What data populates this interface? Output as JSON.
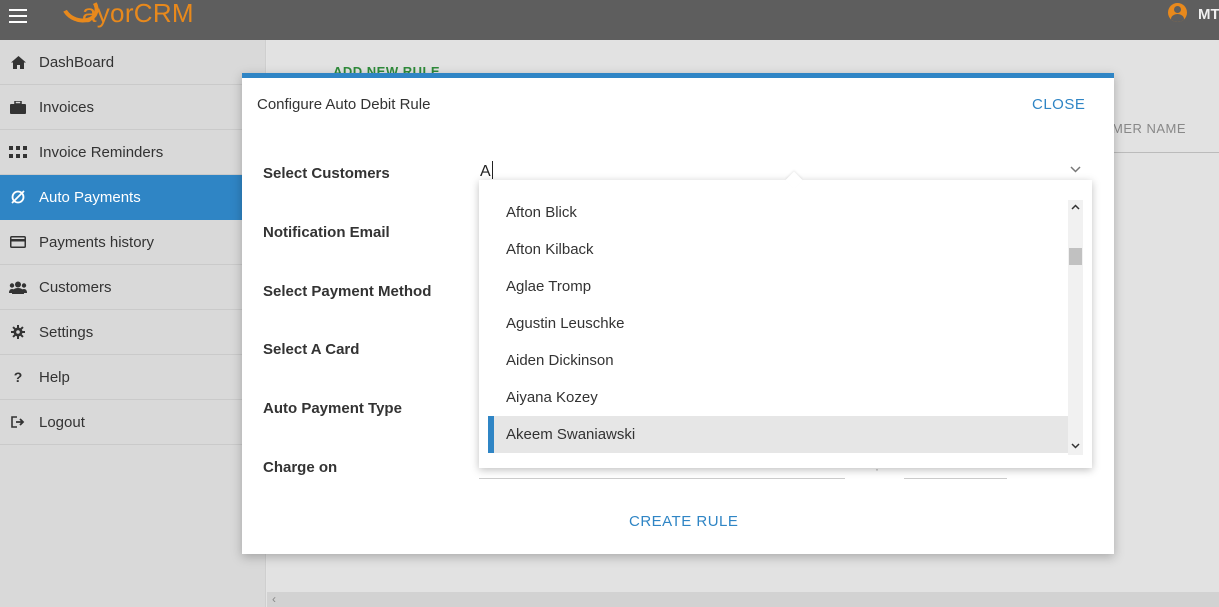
{
  "app": {
    "logo_text": "ayorCRM",
    "user_initials": "MT"
  },
  "sidebar": {
    "items": [
      {
        "label": "DashBoard",
        "icon": "home-icon",
        "active": false
      },
      {
        "label": "Invoices",
        "icon": "briefcase-icon",
        "active": false
      },
      {
        "label": "Invoice Reminders",
        "icon": "grid-icon",
        "active": false
      },
      {
        "label": "Auto Payments",
        "icon": "refresh-icon",
        "active": true
      },
      {
        "label": "Payments history",
        "icon": "credit-card-icon",
        "active": false
      },
      {
        "label": "Customers",
        "icon": "users-icon",
        "active": false
      },
      {
        "label": "Settings",
        "icon": "gear-icon",
        "active": false
      },
      {
        "label": "Help",
        "icon": "question-icon",
        "active": false
      },
      {
        "label": "Logout",
        "icon": "logout-icon",
        "active": false
      }
    ]
  },
  "background": {
    "add_rule_label": "ADD NEW RULE",
    "column_header": "MER NAME"
  },
  "modal": {
    "title": "Configure Auto Debit Rule",
    "close_label": "CLOSE",
    "labels": {
      "select_customers": "Select Customers",
      "notification_email": "Notification Email",
      "select_payment_method": "Select Payment Method",
      "select_card": "Select A Card",
      "auto_payment_type": "Auto Payment Type",
      "charge_on": "Charge on"
    },
    "customer_input_value": "A",
    "create_label": "CREATE RULE"
  },
  "dropdown": {
    "options": [
      "Afton Blick",
      "Afton Kilback",
      "Aglae Tromp",
      "Agustin Leuschke",
      "Aiden Dickinson",
      "Aiyana Kozey",
      "Akeem Swaniawski"
    ],
    "highlighted": "Akeem Swaniawski"
  },
  "colors": {
    "accent": "#2f85c5",
    "brand": "#e8891c",
    "topbar": "#5e5e5e",
    "add_rule_green": "#2e8b3a"
  }
}
